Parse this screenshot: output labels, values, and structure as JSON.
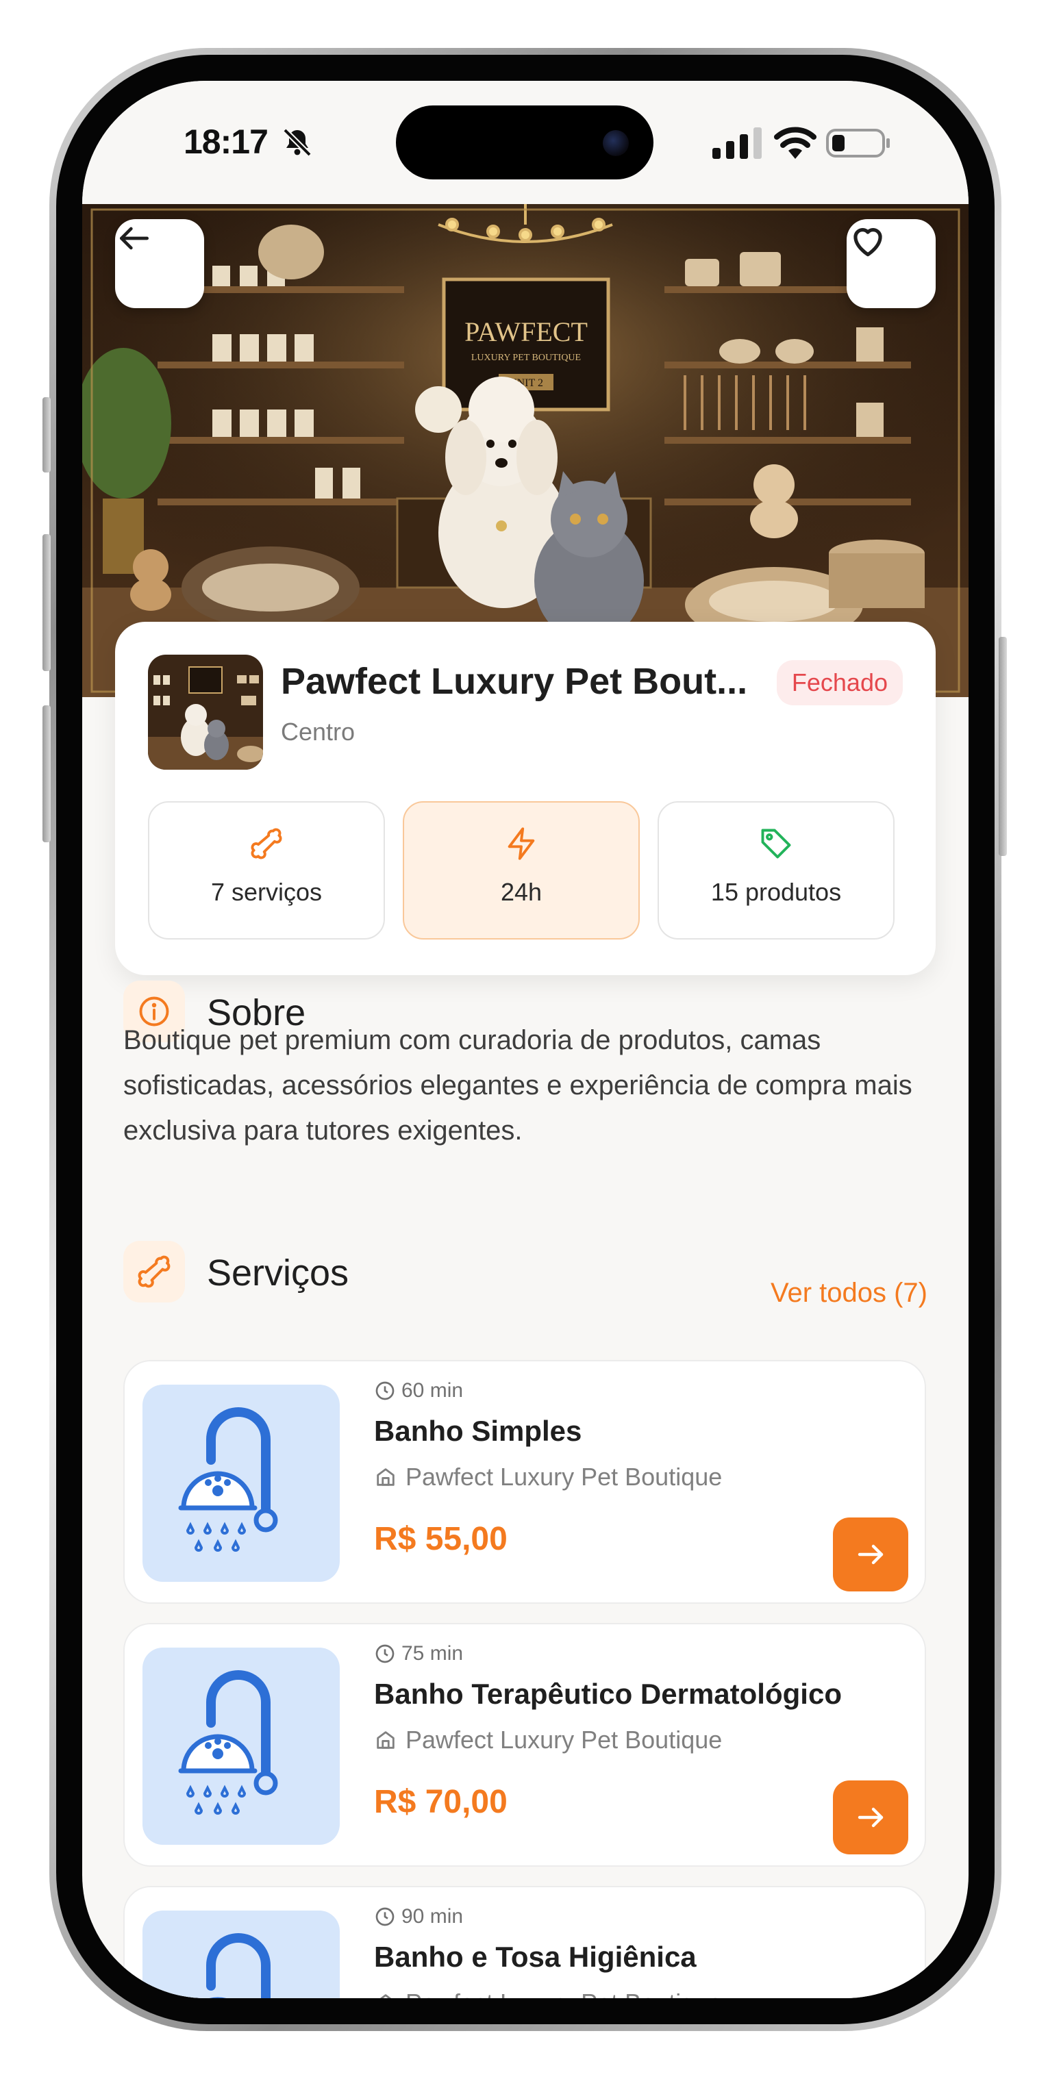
{
  "status_bar": {
    "time": "18:17"
  },
  "store": {
    "name": "Pawfect Luxury Pet Bout...",
    "location": "Centro",
    "status": "Fechado",
    "sign_title": "PAWFECT",
    "sign_subtitle": "LUXURY PET BOUTIQUE",
    "sign_unit": "UNIT 2"
  },
  "stats": [
    {
      "label": "7 serviços",
      "icon": "bone-icon"
    },
    {
      "label": "24h",
      "icon": "lightning-icon"
    },
    {
      "label": "15 produtos",
      "icon": "tag-icon"
    }
  ],
  "about": {
    "title": "Sobre",
    "text": "Boutique pet premium com curadoria de produtos, camas sofisticadas, acessórios elegantes e experiência de compra mais exclusiva para tutores exigentes."
  },
  "services": {
    "title": "Serviços",
    "see_all": "Ver todos (7)",
    "items": [
      {
        "duration": "60 min",
        "name": "Banho Simples",
        "store": "Pawfect Luxury Pet Boutique",
        "price": "R$ 55,00"
      },
      {
        "duration": "75 min",
        "name": "Banho Terapêutico Dermatológico",
        "store": "Pawfect Luxury Pet Boutique",
        "price": "R$ 70,00"
      },
      {
        "duration": "90 min",
        "name": "Banho e Tosa Higiênica",
        "store": "Pawfect Luxury Pet Boutique",
        "price": ""
      }
    ]
  },
  "colors": {
    "accent": "#f47a1f",
    "closed_badge": "#e5484d",
    "service_thumb_bg": "#d6e6fb"
  }
}
